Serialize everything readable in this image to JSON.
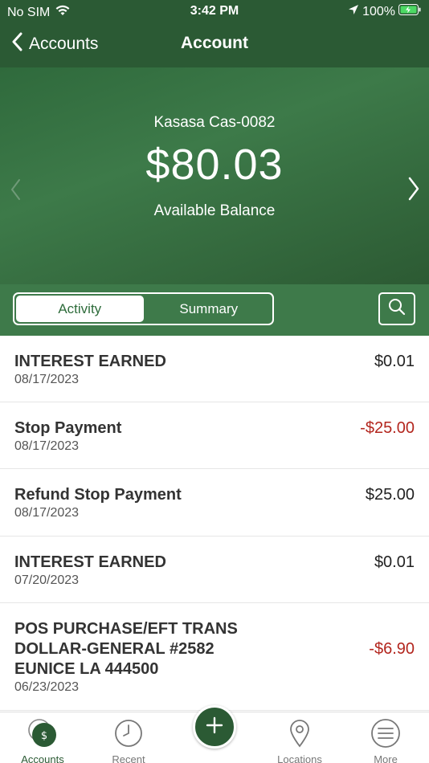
{
  "status": {
    "carrier": "No SIM",
    "time": "3:42 PM",
    "battery": "100%"
  },
  "nav": {
    "back_label": "Accounts",
    "title": "Account"
  },
  "account": {
    "name": "Kasasa Cas-0082",
    "balance": "$80.03",
    "balance_label": "Available Balance"
  },
  "tabs_segment": {
    "activity": "Activity",
    "summary": "Summary",
    "selected": "Activity"
  },
  "transactions": [
    {
      "description": "INTEREST EARNED",
      "date": "08/17/2023",
      "amount": "$0.01",
      "negative": false
    },
    {
      "description": "Stop Payment",
      "date": "08/17/2023",
      "amount": "-$25.00",
      "negative": true
    },
    {
      "description": "Refund Stop Payment",
      "date": "08/17/2023",
      "amount": "$25.00",
      "negative": false
    },
    {
      "description": "INTEREST EARNED",
      "date": "07/20/2023",
      "amount": "$0.01",
      "negative": false
    },
    {
      "description": "POS PURCHASE/EFT TRANS DOLLAR-GENERAL #2582 EUNICE LA 444500",
      "date": "06/23/2023",
      "amount": "-$6.90",
      "negative": true
    }
  ],
  "tab_bar": {
    "accounts": "Accounts",
    "recent": "Recent",
    "locations": "Locations",
    "more": "More",
    "accounts_badge": "$"
  },
  "colors": {
    "brand_green": "#2b5a34",
    "negative_red": "#b3261e"
  }
}
